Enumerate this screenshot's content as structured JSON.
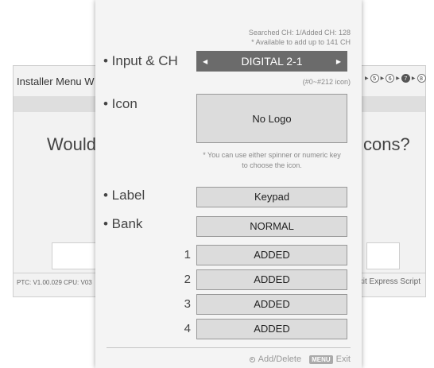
{
  "background": {
    "title": "Installer Menu W",
    "question_left": "Would",
    "question_right": "cons?",
    "status": "PTC:  V1.00.029 CPU: V03",
    "exit_label": "Exit Express Script",
    "steps": [
      "5",
      "6",
      "7",
      "8"
    ],
    "active_step": "7"
  },
  "panel": {
    "searched_info": "Searched CH: 1/Added CH: 128",
    "available_info": "* Available to add up to 141 CH",
    "input_ch_label": "• Input & CH",
    "channel_value": "DIGITAL 2-1",
    "icon_range": "(#0~#212 icon)",
    "icon_label": "• Icon",
    "icon_value": "No Logo",
    "hint_line1": "* You can use either spinner or numeric key",
    "hint_line2": "to choose the icon.",
    "label_label": "• Label",
    "label_value": "Keypad",
    "bank_label": "• Bank",
    "bank_value": "NORMAL",
    "banks": [
      {
        "number": "1",
        "value": "ADDED"
      },
      {
        "number": "2",
        "value": "ADDED"
      },
      {
        "number": "3",
        "value": "ADDED"
      },
      {
        "number": "4",
        "value": "ADDED"
      }
    ],
    "footer_add_delete": "Add/Delete",
    "footer_menu_key": "MENU",
    "footer_exit": "Exit"
  },
  "icons": {
    "left_arrow": "left-arrow-icon",
    "right_arrow": "right-arrow-icon",
    "ok_button": "ok-button-icon"
  }
}
